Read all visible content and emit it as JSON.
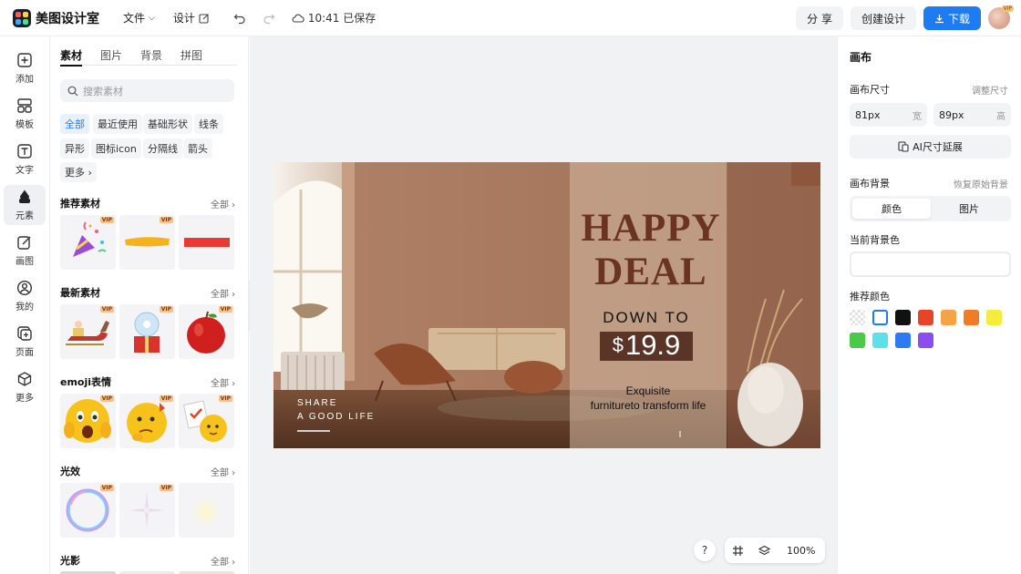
{
  "app": {
    "name": "美图设计室"
  },
  "topbar": {
    "file_label": "文件",
    "design_label": "设计",
    "saved_label": "10:41 已保存",
    "share_label": "分 享",
    "create_label": "创建设计",
    "download_label": "下载",
    "avatar_badge": "VIP"
  },
  "leftnav": [
    {
      "label": "添加",
      "icon": "plus-square-icon"
    },
    {
      "label": "模板",
      "icon": "template-icon"
    },
    {
      "label": "文字",
      "icon": "text-icon"
    },
    {
      "label": "元素",
      "icon": "shapes-icon"
    },
    {
      "label": "画图",
      "icon": "pen-edit-icon"
    },
    {
      "label": "我的",
      "icon": "user-icon"
    },
    {
      "label": "页面",
      "icon": "page-add-icon"
    },
    {
      "label": "更多",
      "icon": "cube-icon"
    }
  ],
  "panel": {
    "tabs": [
      "素材",
      "图片",
      "背景",
      "拼图"
    ],
    "search_placeholder": "搜索素材",
    "chips": [
      "全部",
      "最近使用",
      "基础形状",
      "线条",
      "异形",
      "图标icon",
      "分隔线",
      "箭头",
      "更多"
    ],
    "all_label": "全部",
    "vip_label": "VIP",
    "sections": [
      {
        "title": "推荐素材"
      },
      {
        "title": "最新素材"
      },
      {
        "title": "emoji表情"
      },
      {
        "title": "光效"
      },
      {
        "title": "光影"
      }
    ]
  },
  "canvas_design": {
    "headline_1": "HAPPY",
    "headline_2": "DEAL",
    "down_to": "DOWN TO",
    "currency": "$",
    "price": "19.9",
    "tag_1": "Exquisite",
    "tag_2": "furnitureto transform life",
    "share_1": "SHARE",
    "share_2": "A GOOD LIFE"
  },
  "canvas_controls": {
    "help": "?",
    "zoom": "100%"
  },
  "right_panel": {
    "title": "画布",
    "size_label": "画布尺寸",
    "adjust_label": "调整尺寸",
    "width_value": "81px",
    "width_unit": "宽",
    "height_value": "89px",
    "height_unit": "高",
    "ai_extend_label": "AI尺寸延展",
    "bg_label": "画布背景",
    "restore_label": "恢复原始背景",
    "seg_color": "颜色",
    "seg_image": "图片",
    "current_bg_label": "当前背景色",
    "recommend_label": "推荐颜色",
    "colors": [
      "transparent",
      "#ffffff",
      "#111111",
      "#e8442a",
      "#f5a445",
      "#f07c2a",
      "#f6ec3d",
      "#4dc94a",
      "#5ee0e6",
      "#2e7bf0",
      "#8b4cf0"
    ]
  }
}
